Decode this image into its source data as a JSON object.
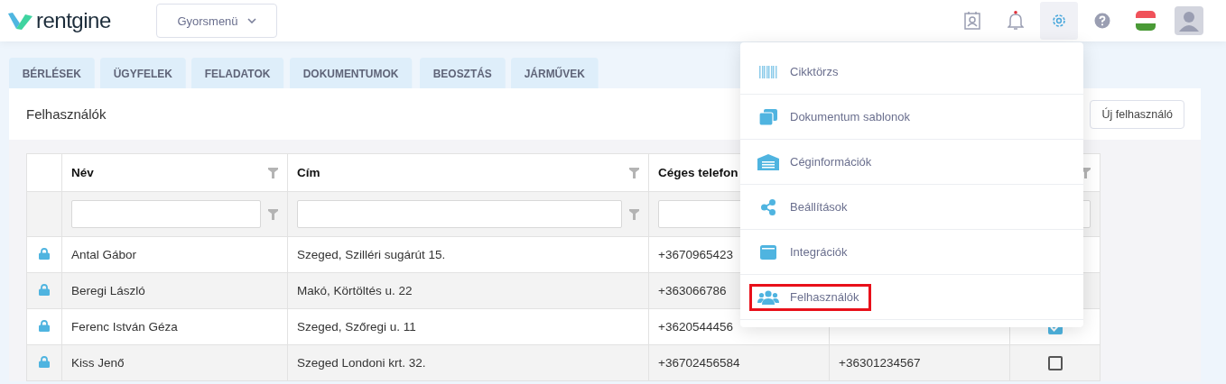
{
  "logo": {
    "text": "rentgine"
  },
  "quick_menu": {
    "label": "Gyorsmenü"
  },
  "tabs": [
    {
      "label": "BÉRLÉSEK",
      "selected": false
    },
    {
      "label": "ÜGYFELEK",
      "selected": false
    },
    {
      "label": "FELADATOK",
      "selected": false
    },
    {
      "label": "DOKUMENTUMOK",
      "selected": false
    },
    {
      "label": "BEOSZTÁS",
      "selected": false
    },
    {
      "label": "JÁRMŰVEK",
      "selected": false
    }
  ],
  "notifications": {
    "unread": true
  },
  "page": {
    "title": "Felhasználók",
    "new_button": "Új felhasználó"
  },
  "table": {
    "columns": [
      {
        "label": "Név",
        "filter": true
      },
      {
        "label": "Cím",
        "filter": true
      },
      {
        "label": "Céges telefon",
        "filter": false
      }
    ],
    "rows": [
      {
        "locked": true,
        "name": "Antal Gábor",
        "address": "Szeged, Szilléri sugárút 15.",
        "phone": "+3670965423"
      },
      {
        "locked": true,
        "name": "Beregi László",
        "address": "Makó, Körtöltés u. 22",
        "phone": "+363066786"
      },
      {
        "locked": true,
        "name": "Ferenc István Géza",
        "address": "Szeged, Szőregi u. 11",
        "phone": "+3620544456",
        "checked": true
      },
      {
        "locked": true,
        "name": "Kiss Jenő",
        "address": "Szeged Londoni krt. 32.",
        "phone": "+36702456584",
        "phone2": "+36301234567",
        "checked": false
      }
    ]
  },
  "settings_menu": {
    "items": [
      {
        "label": "Cikktörzs",
        "kind": "barcode",
        "selected": false
      },
      {
        "label": "Dokumentum sablonok",
        "kind": "copies",
        "selected": false
      },
      {
        "label": "Céginformációk",
        "kind": "building",
        "selected": false
      },
      {
        "label": "Beállítások",
        "kind": "share",
        "selected": false
      },
      {
        "label": "Integrációk",
        "kind": "wallet",
        "selected": false
      },
      {
        "label": "Felhasználók",
        "kind": "users",
        "selected": true
      }
    ]
  }
}
